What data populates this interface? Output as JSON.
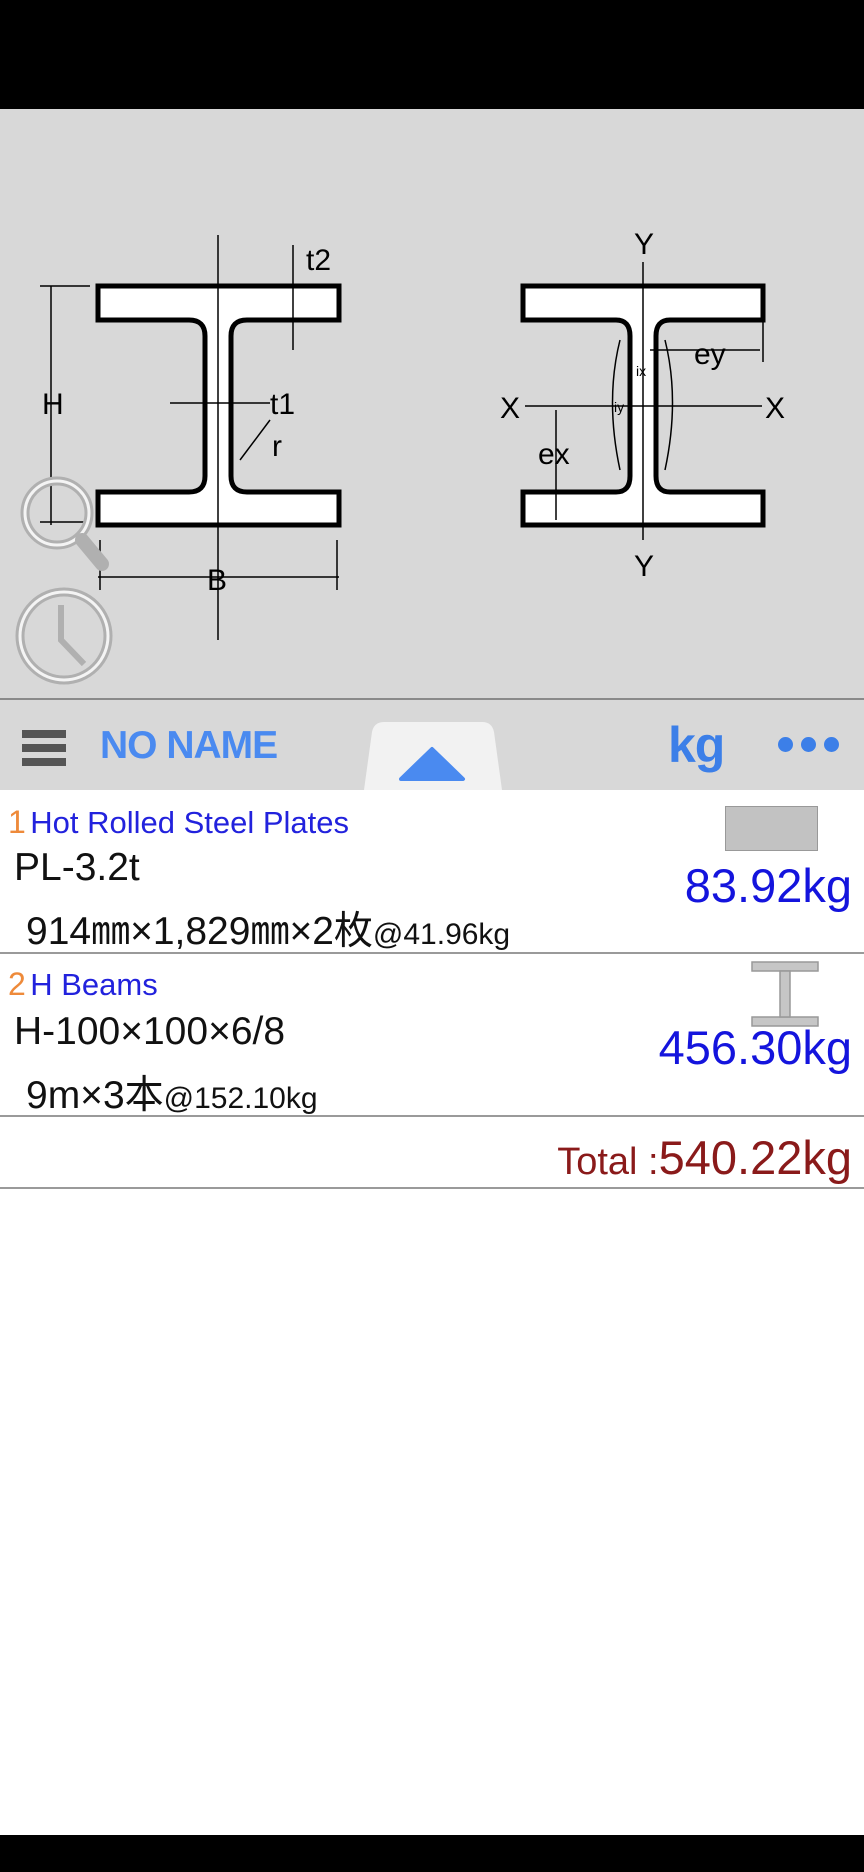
{
  "diagram": {
    "left_labels": {
      "t2": "t2",
      "H": "H",
      "t1": "t1",
      "r": "r",
      "B": "B"
    },
    "right_labels": {
      "y_top": "Y",
      "y_bottom": "Y",
      "x_left": "X",
      "x_right": "X",
      "ex": "ex",
      "ey": "ey",
      "ix": "ix",
      "iy": "iy"
    },
    "overlay_icons": [
      "magnifier-icon",
      "clock-icon"
    ]
  },
  "toolbar": {
    "menu_icon": "hamburger-icon",
    "name": "NO NAME",
    "expand_icon": "triangle-up-icon",
    "unit": "kg",
    "more_icon": "more-dots-icon",
    "accent": "#3c7fe8"
  },
  "items": [
    {
      "index": "1",
      "category": "Hot Rolled Steel Plates",
      "spec": "PL-3.2t",
      "dims": "914㎜×1,829㎜×2枚",
      "unit_weight": "@41.96kg",
      "weight": "83.92kg",
      "icon": "plate-icon"
    },
    {
      "index": "2",
      "category": "H Beams",
      "spec": "H-100×100×6/8",
      "dims": "9m×3本",
      "unit_weight": "@152.10kg",
      "weight": "456.30kg",
      "icon": "h-beam-icon"
    }
  ],
  "total": {
    "label": "Total :",
    "value": "540.22kg",
    "color": "#8a1a1a"
  }
}
